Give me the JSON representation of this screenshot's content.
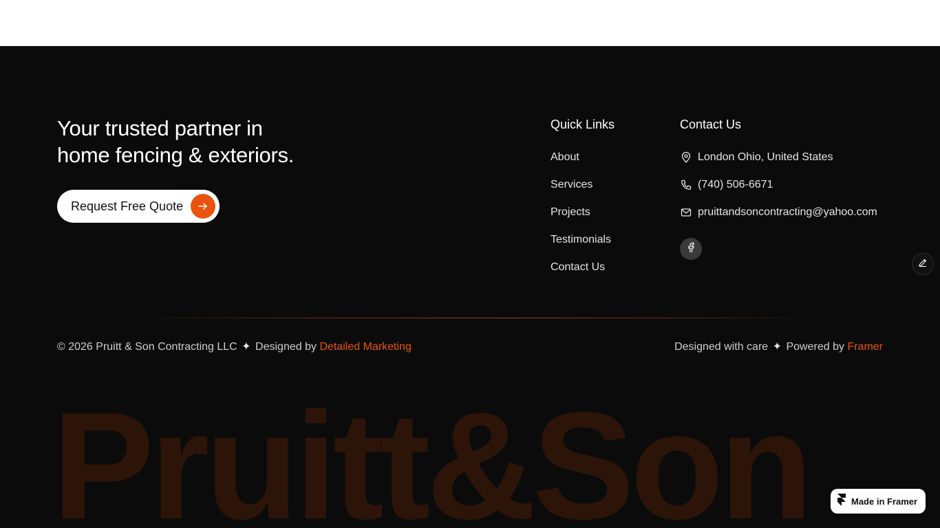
{
  "tagline": {
    "line1": "Your trusted partner in",
    "line2": "home fencing & exteriors."
  },
  "cta": {
    "label": "Request Free Quote",
    "icon": "arrow-right-icon",
    "accent": "#e8540f"
  },
  "quick_links": {
    "title": "Quick Links",
    "items": [
      "About",
      "Services",
      "Projects",
      "Testimonials",
      "Contact Us"
    ]
  },
  "contact": {
    "title": "Contact Us",
    "address": "London Ohio, United States",
    "phone": "(740) 506-6671",
    "email": "pruittandsoncontracting@yahoo.com",
    "social": "facebook-icon"
  },
  "bottom": {
    "copyright": "© 2026 Pruitt & Son Contracting LLC",
    "separator": "✦",
    "designed_by_prefix": "Designed by",
    "designed_by_link": "Detailed Marketing",
    "care_text": "Designed with care",
    "powered_prefix": "Powered by",
    "powered_link": "Framer"
  },
  "big_wordmark": "Pruitt&Son",
  "framer_badge": "Made in Framer",
  "colors": {
    "background": "#0b0b0b",
    "accent": "#e8540f",
    "wordmark": "#2c1409"
  }
}
